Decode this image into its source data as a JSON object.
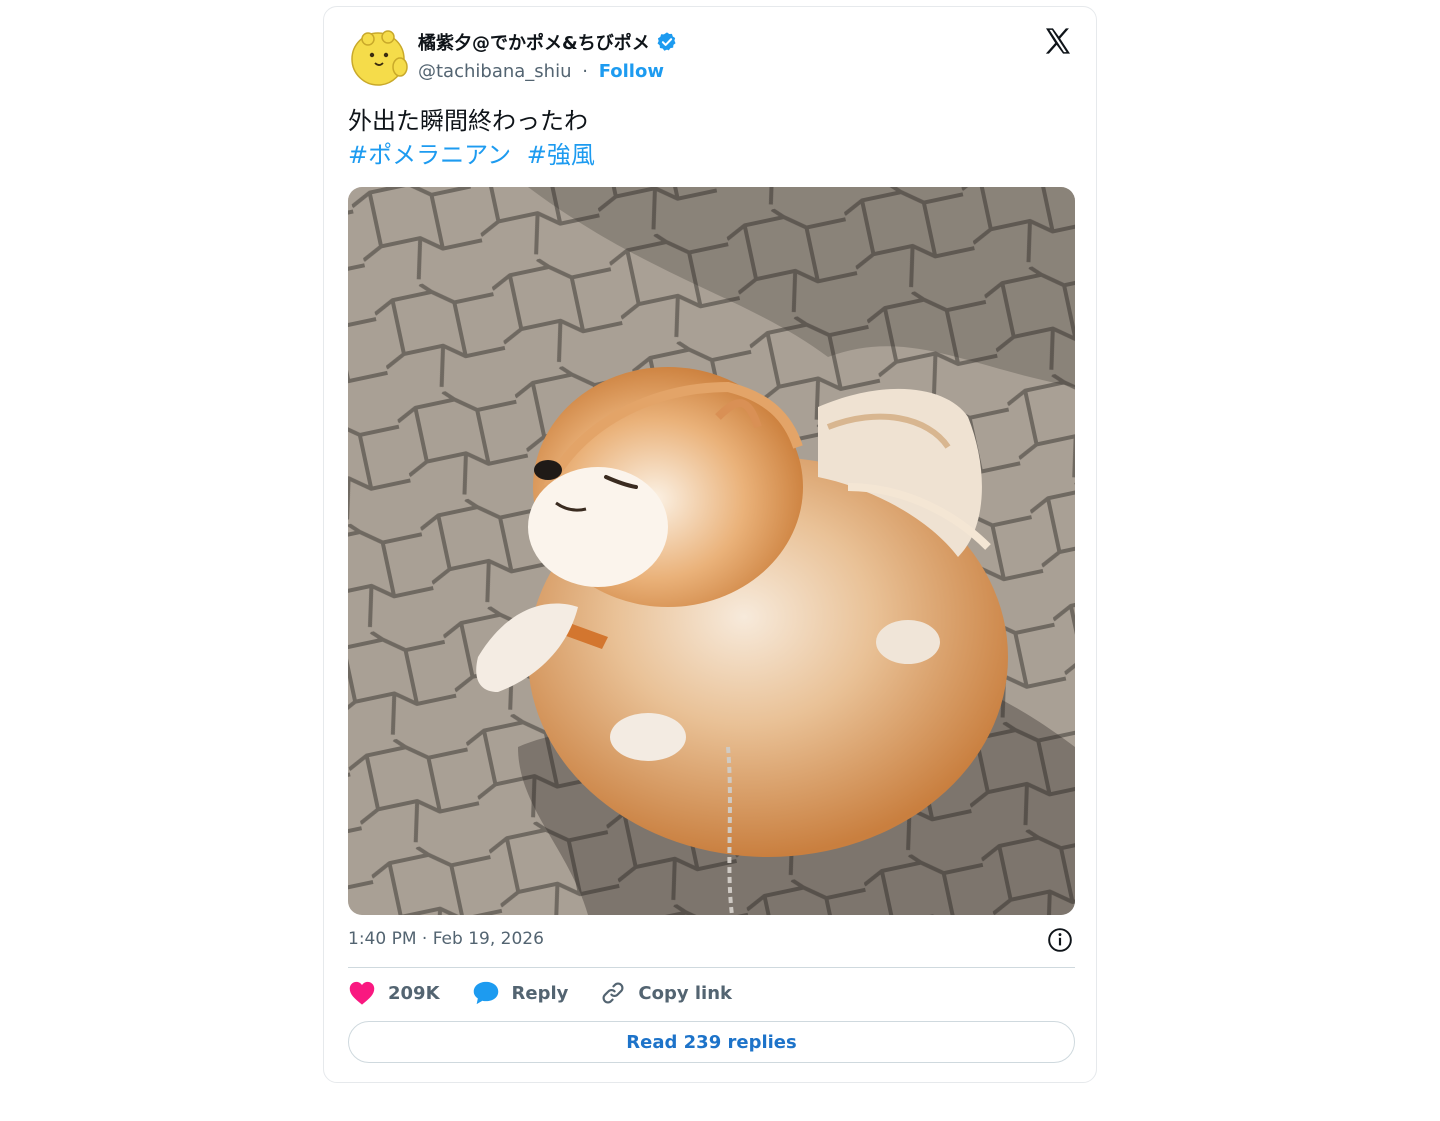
{
  "tweet": {
    "author": {
      "display_name": "橘紫夕@でかポメ&ちびポメ",
      "handle": "@tachibana_shiu",
      "separator": "·",
      "follow_label": "Follow",
      "verified": true
    },
    "text": "外出た瞬間終わったわ",
    "hashtags": [
      "#ポメラニアン",
      "#強風"
    ],
    "timestamp": "1:40 PM · Feb 19, 2026",
    "likes": "209K",
    "reply_label": "Reply",
    "copy_link_label": "Copy link",
    "read_replies_label": "Read 239 replies"
  },
  "icons": {
    "logo": "x-logo-icon",
    "verified": "verified-badge-icon",
    "info": "info-icon",
    "like": "heart-icon",
    "reply": "reply-bubble-icon",
    "copy": "link-icon"
  },
  "colors": {
    "accent": "#1d9bf0",
    "like": "#f91880",
    "muted": "#536471",
    "text": "#0f1419"
  }
}
